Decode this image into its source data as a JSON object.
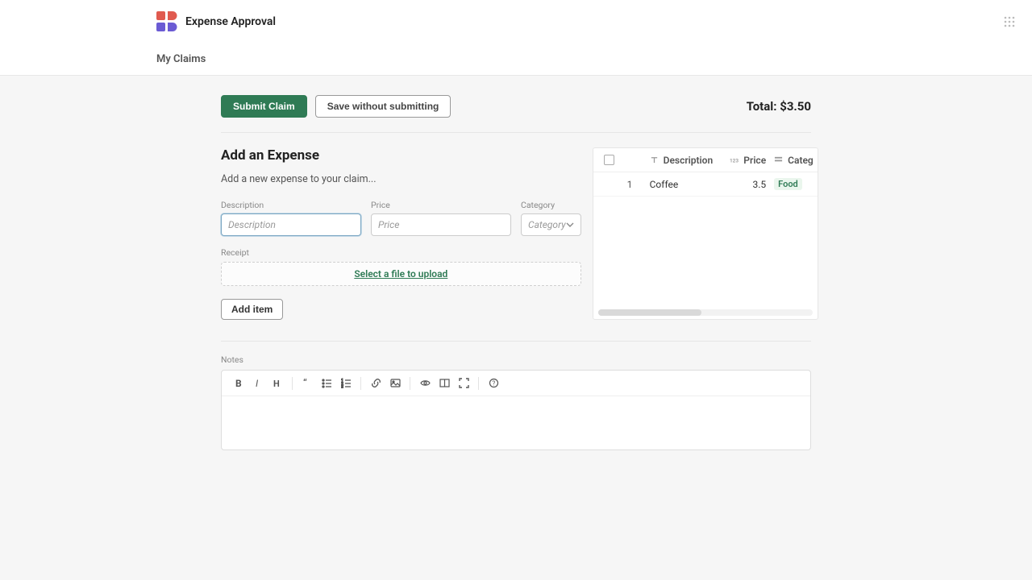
{
  "header": {
    "app_title": "Expense Approval"
  },
  "nav": {
    "my_claims": "My Claims"
  },
  "actions": {
    "submit": "Submit Claim",
    "save": "Save without submitting",
    "total_label": "Total: ",
    "total_value": "$3.50"
  },
  "form": {
    "title": "Add an Expense",
    "subtitle": "Add a new expense to your claim...",
    "description_label": "Description",
    "description_placeholder": "Description",
    "price_label": "Price",
    "price_placeholder": "Price",
    "category_label": "Category",
    "category_placeholder": "Category",
    "receipt_label": "Receipt",
    "upload_text": "Select a file to upload",
    "add_item": "Add item"
  },
  "table": {
    "headers": {
      "description": "Description",
      "price": "Price",
      "category": "Categ"
    },
    "rows": [
      {
        "idx": "1",
        "description": "Coffee",
        "price": "3.5",
        "category": "Food"
      }
    ]
  },
  "notes": {
    "label": "Notes"
  }
}
